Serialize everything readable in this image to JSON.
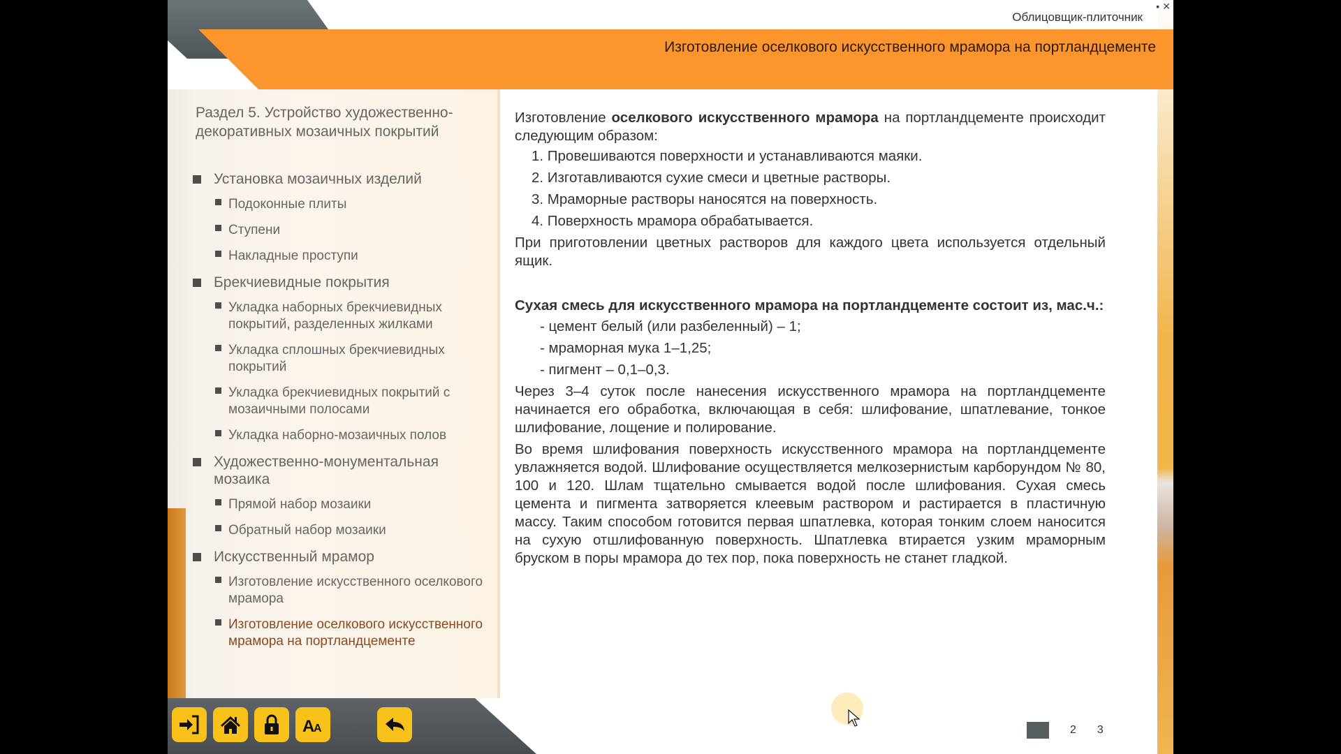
{
  "window": {
    "app_name": "Облицовщик-плиточник",
    "minimize_icon": "minimize-icon",
    "close_icon": "close-icon",
    "minimize_label": "▪",
    "close_label": "✕"
  },
  "header": {
    "title": "Изготовление оселкового искусственного мрамора на портландцементе"
  },
  "sidebar": {
    "section_title": "Раздел 5. Устройство художественно-декоративных мозаичных покрытий",
    "items": [
      {
        "level": 1,
        "label": "Установка мозаичных изделий"
      },
      {
        "level": 2,
        "label": "Подоконные плиты"
      },
      {
        "level": 2,
        "label": "Ступени"
      },
      {
        "level": 2,
        "label": "Накладные проступи"
      },
      {
        "level": 1,
        "label": "Брекчиевидные покрытия"
      },
      {
        "level": 2,
        "label": "Укладка наборных брекчиевидных покрытий, разделенных жилками"
      },
      {
        "level": 2,
        "label": "Укладка сплошных брекчиевидных покрытий"
      },
      {
        "level": 2,
        "label": "Укладка брекчиевидных покрытий с мозаичными полосами"
      },
      {
        "level": 2,
        "label": "Укладка наборно-мозаичных полов"
      },
      {
        "level": 1,
        "label": "Художественно-монументальная мозаика"
      },
      {
        "level": 2,
        "label": "Прямой набор мозаики"
      },
      {
        "level": 2,
        "label": "Обратный набор мозаики"
      },
      {
        "level": 1,
        "label": "Искусственный мрамор"
      },
      {
        "level": 2,
        "label": "Изготовление искусственного оселкового мрамора"
      },
      {
        "level": 2,
        "label": "Изготовление оселкового искусственного мрамора на портландцементе",
        "active": true
      }
    ]
  },
  "toolbar": {
    "buttons": [
      {
        "name": "exit",
        "icon": "sign-in-icon",
        "tooltip": ""
      },
      {
        "name": "home",
        "icon": "home-icon"
      },
      {
        "name": "lock",
        "icon": "lock-icon"
      },
      {
        "name": "font-size",
        "icon": "font-size-icon"
      },
      {
        "name": "back",
        "icon": "reply-arrow-icon"
      }
    ]
  },
  "content": {
    "intro_prefix": "Изготовление ",
    "intro_bold": "оселкового искусственного мрамора",
    "intro_suffix": " на портландцементе происходит следующим образом:",
    "steps": [
      "1. Провешиваются поверхности и устанавливаются маяки.",
      "2. Изготавливаются сухие смеси и цветные растворы.",
      "3. Мраморные растворы наносятся на поверхность.",
      "4. Поверхность мрамора обрабатывается."
    ],
    "para_colors": "При приготовлении цветных растворов для каждого цвета используется отдельный ящик.",
    "mix_heading": "Сухая смесь для искусственного мрамора на портландцементе состоит из, мас.ч.:",
    "mix_items": [
      "- цемент белый (или разбеленный) – 1;",
      "- мраморная мука 1–1,25;",
      "- пигмент – 0,1–0,3."
    ],
    "para_processing": "Через 3–4 суток после нанесения искусственного мрамора на портландцементе начинается его обработка, включающая в себя: шлифование, шпатлевание, тонкое шлифование, лощение и полирование.",
    "para_grinding": "Во время шлифования поверхность искусственного мрамора на портландцементе увлажняется водой. Шлифование осуществляется мелкозернистым карборундом № 80, 100 и 120. Шлам тщательно смывается водой после шлифования. Сухая смесь цемента и пигмента затворяется клеевым раствором и растирается в пластичную массу. Таким способом готовится первая шпатлевка, которая тонким слоем наносится на сухую отшлифованную поверхность. Шпатлевка втирается узким мраморным бруском в поры мрамора до тех пор, пока поверхность не станет гладкой."
  },
  "pager": {
    "current": "1",
    "pages": [
      "2",
      "3"
    ]
  },
  "colors": {
    "accent_orange": "#fb952e",
    "button_yellow": "#f9c21b",
    "toolbar_grey": "#52585b",
    "active_item": "#8a4a1e"
  }
}
